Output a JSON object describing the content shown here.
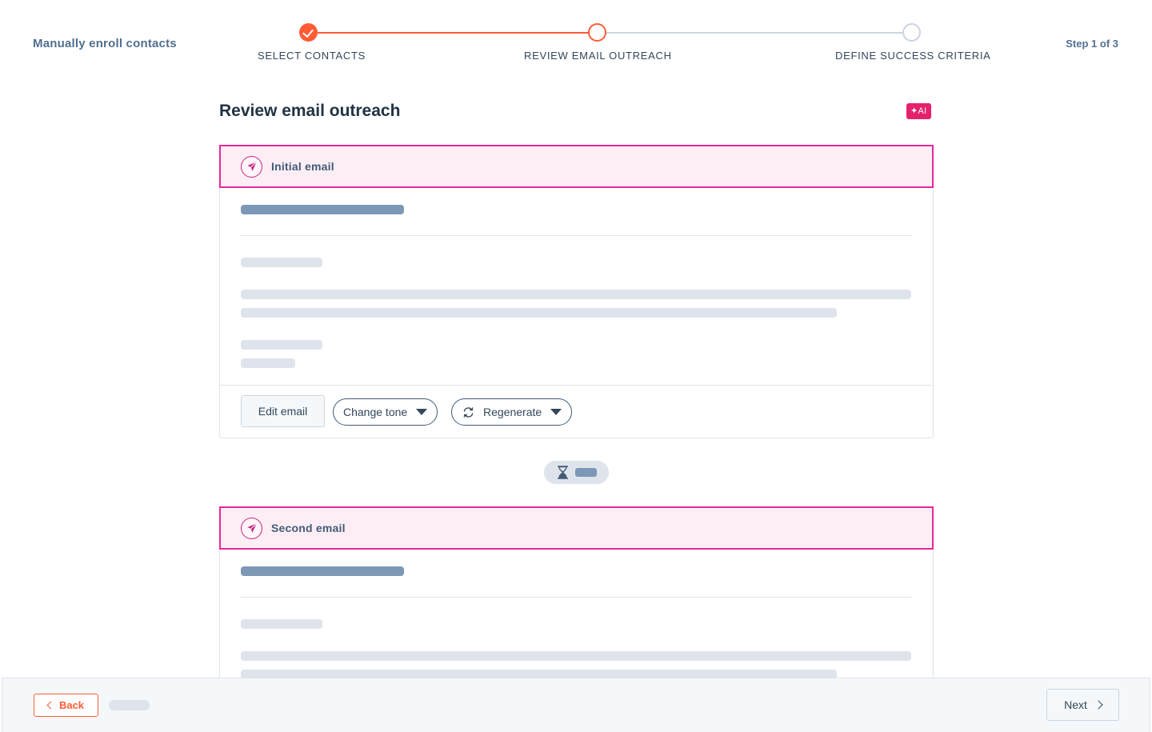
{
  "header": {
    "page_heading": "Manually enroll contacts",
    "step_counter": "Step 1 of 3",
    "steps": [
      {
        "label": "SELECT CONTACTS",
        "state": "complete"
      },
      {
        "label": "REVIEW EMAIL OUTREACH",
        "state": "active"
      },
      {
        "label": "DEFINE SUCCESS CRITERIA",
        "state": "upcoming"
      }
    ]
  },
  "content": {
    "title": "Review email outreach",
    "ai_badge": "✦AI",
    "emails": [
      {
        "title": "Initial email",
        "actions": {
          "edit_label": "Edit email",
          "tone_label": "Change tone",
          "regenerate_label": "Regenerate"
        }
      },
      {
        "title": "Second email"
      }
    ]
  },
  "footer": {
    "back_label": "Back",
    "next_label": "Next"
  },
  "colors": {
    "accent": "#ff5c35",
    "email_header_bg": "#fdeef5",
    "email_header_border": "#e5299a",
    "ai_badge_bg": "#e5216e",
    "skeleton_dark": "#7c98b6",
    "skeleton_light": "#dfe3eb"
  },
  "icons": {
    "step_complete": "check-icon",
    "email": "paper-plane-icon",
    "regenerate": "refresh-icon",
    "delay": "hourglass-icon",
    "back": "chevron-left-icon",
    "next": "chevron-right-icon"
  }
}
